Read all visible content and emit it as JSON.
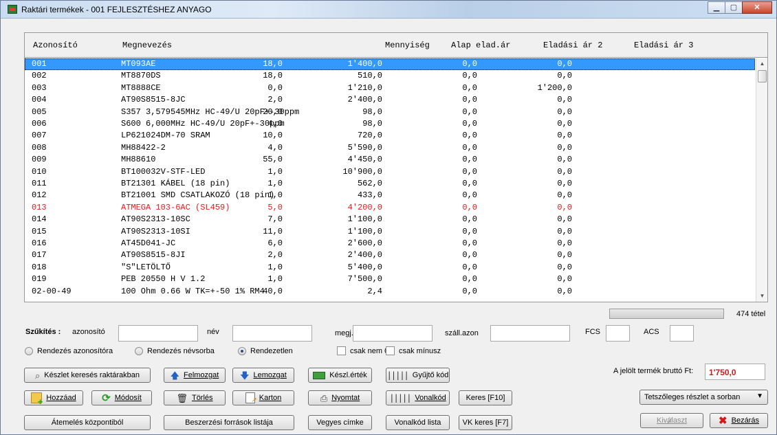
{
  "window": {
    "title": "Raktári termékek - 001 FEJLESZTÉSHEZ ANYAGO"
  },
  "colors": {
    "selection": "#3399ff",
    "highlight_row": "#e51c1c",
    "total_value": "#d01919"
  },
  "grid": {
    "columns": [
      "Azonosító",
      "Megnevezés",
      "Mennyiség",
      "Alap elad.ár",
      "Eladási ár 2",
      "Eladási ár 3"
    ],
    "rows": [
      {
        "id": "001",
        "name": "MT093AE",
        "qty": "18,0",
        "p1": "1'400,0",
        "p2": "0,0",
        "p3": "0,0",
        "state": "selected"
      },
      {
        "id": "002",
        "name": "MT8870DS",
        "qty": "18,0",
        "p1": "510,0",
        "p2": "0,0",
        "p3": "0,0",
        "state": ""
      },
      {
        "id": "003",
        "name": "MT8888CE",
        "qty": "0,0",
        "p1": "1'210,0",
        "p2": "0,0",
        "p3": "1'200,0",
        "state": ""
      },
      {
        "id": "004",
        "name": "AT90S8515-8JC",
        "qty": "2,0",
        "p1": "2'400,0",
        "p2": "0,0",
        "p3": "0,0",
        "state": ""
      },
      {
        "id": "005",
        "name": "S357 3,579545MHz HC-49/U 20pF+-30ppm",
        "qty": "20,0",
        "p1": "98,0",
        "p2": "0,0",
        "p3": "0,0",
        "state": ""
      },
      {
        "id": "006",
        "name": "S600 6,000MHz HC-49/U 20pF+-30ppm",
        "qty": "4,0",
        "p1": "98,0",
        "p2": "0,0",
        "p3": "0,0",
        "state": ""
      },
      {
        "id": "007",
        "name": "LP621024DM-70 SRAM",
        "qty": "10,0",
        "p1": "720,0",
        "p2": "0,0",
        "p3": "0,0",
        "state": ""
      },
      {
        "id": "008",
        "name": "MH88422-2",
        "qty": "4,0",
        "p1": "5'590,0",
        "p2": "0,0",
        "p3": "0,0",
        "state": ""
      },
      {
        "id": "009",
        "name": "MH88610",
        "qty": "55,0",
        "p1": "4'450,0",
        "p2": "0,0",
        "p3": "0,0",
        "state": ""
      },
      {
        "id": "010",
        "name": "BT100032V-STF-LED",
        "qty": "1,0",
        "p1": "10'900,0",
        "p2": "0,0",
        "p3": "0,0",
        "state": ""
      },
      {
        "id": "011",
        "name": "BT21301 KÁBEL (18 pin)",
        "qty": "1,0",
        "p1": "562,0",
        "p2": "0,0",
        "p3": "0,0",
        "state": ""
      },
      {
        "id": "012",
        "name": "BT21001 SMD CSATLAKOZÓ (18 pin)",
        "qty": "1,0",
        "p1": "433,0",
        "p2": "0,0",
        "p3": "0,0",
        "state": ""
      },
      {
        "id": "013",
        "name": "ATMEGA 103-6AC (SL459)",
        "qty": "5,0",
        "p1": "4'200,0",
        "p2": "0,0",
        "p3": "0,0",
        "state": "red"
      },
      {
        "id": "014",
        "name": "AT90S2313-10SC",
        "qty": "7,0",
        "p1": "1'100,0",
        "p2": "0,0",
        "p3": "0,0",
        "state": ""
      },
      {
        "id": "015",
        "name": "AT90S2313-10SI",
        "qty": "11,0",
        "p1": "1'100,0",
        "p2": "0,0",
        "p3": "0,0",
        "state": ""
      },
      {
        "id": "016",
        "name": "AT45D041-JC",
        "qty": "6,0",
        "p1": "2'600,0",
        "p2": "0,0",
        "p3": "0,0",
        "state": ""
      },
      {
        "id": "017",
        "name": "AT90S8515-8JI",
        "qty": "2,0",
        "p1": "2'400,0",
        "p2": "0,0",
        "p3": "0,0",
        "state": ""
      },
      {
        "id": "018",
        "name": "\"S\"LETÖLTŐ",
        "qty": "1,0",
        "p1": "5'400,0",
        "p2": "0,0",
        "p3": "0,0",
        "state": ""
      },
      {
        "id": "019",
        "name": "PEB 20550 H V 1.2",
        "qty": "1,0",
        "p1": "7'500,0",
        "p2": "0,0",
        "p3": "0,0",
        "state": ""
      },
      {
        "id": "02-00-49",
        "name": "100 Ohm 0.66 W TK=+-50 1% RM4",
        "qty": "40,0",
        "p1": "2,4",
        "p2": "0,0",
        "p3": "0,0",
        "state": ""
      }
    ]
  },
  "count_label": "474 tétel",
  "filters": {
    "title": "Szűkítés :",
    "id_label": "azonosító",
    "name_label": "név",
    "desc_label": "megj.",
    "supplier_label": "száll.azon",
    "fcs_label": "FCS",
    "acs_label": "ACS"
  },
  "sorting": {
    "by_id": "Rendezés azonosítóra",
    "by_name": "Rendezés névsorba",
    "unsorted": "Rendezetlen",
    "not_zero": "csak nem 0",
    "minus_only": "csak mínusz"
  },
  "buttons": {
    "stock_search": "Készlet keresés raktárakban",
    "move_up": "Felmozgat",
    "move_down": "Lemozgat",
    "stock_value": "Készl.érték",
    "collector_code": "Gyűjtő kód",
    "add": "Hozzáad",
    "modify": "Módosít",
    "delete": "Törlés",
    "card": "Karton",
    "print": "Nyomtat",
    "barcode": "Vonalkód",
    "search_f10": "Keres [F10]",
    "transfer_central": "Átemelés központiból",
    "procurement_list": "Beszerzési források listája",
    "mixed_label": "Vegyes címke",
    "barcode_list": "Vonalkód lista",
    "vk_search": "VK keres [F7]",
    "select": "Kiválaszt",
    "close": "Bezárás"
  },
  "total": {
    "label": "A jelölt termék bruttó Ft:",
    "value": "1'750,0"
  },
  "dropdown": {
    "selected": "Tetszőleges részlet a sorban"
  }
}
